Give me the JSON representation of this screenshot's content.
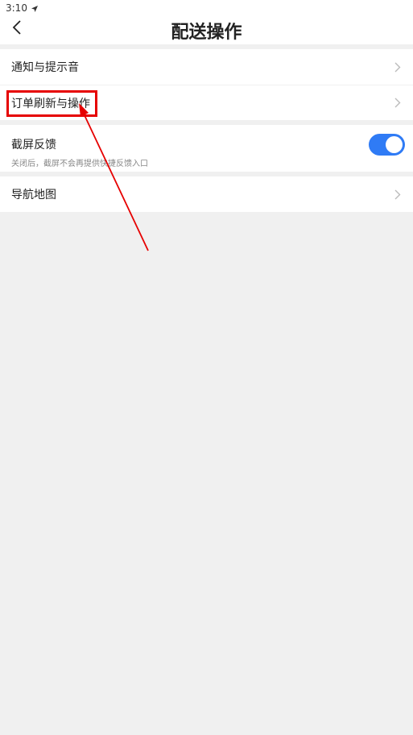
{
  "status_bar": {
    "time": "3:10"
  },
  "header": {
    "title": "配送操作",
    "back_icon": "chevron-left-icon"
  },
  "groups": [
    {
      "items": [
        {
          "label": "通知与提示音",
          "icon": "chevron-right-icon"
        },
        {
          "label": "订单刷新与操作",
          "icon": "chevron-right-icon"
        }
      ]
    },
    {
      "items": [
        {
          "label": "截屏反馈",
          "sublabel": "关闭后，截屏不会再提供快捷反馈入口",
          "toggle_on": true
        }
      ]
    },
    {
      "items": [
        {
          "label": "导航地图",
          "icon": "chevron-right-icon"
        }
      ]
    }
  ],
  "colors": {
    "accent": "#2f7bf5",
    "annotation": "#e60000",
    "background": "#f0f0f0"
  }
}
